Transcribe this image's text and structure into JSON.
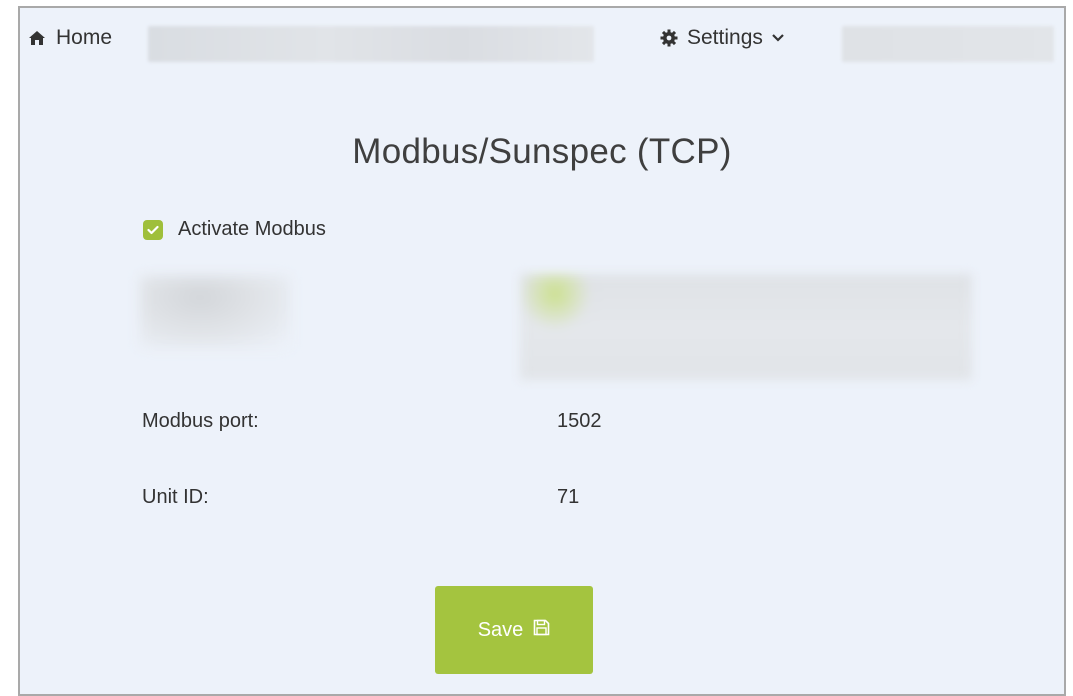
{
  "nav": {
    "home_label": "Home",
    "home_icon": "home-icon",
    "settings_label": "Settings",
    "settings_icon": "gear-icon",
    "dropdown_icon": "caret-down-icon"
  },
  "page": {
    "title": "Modbus/Sunspec (TCP)"
  },
  "activate": {
    "label": "Activate Modbus",
    "checked": true
  },
  "fields": {
    "port": {
      "label": "Modbus port:",
      "value": "1502"
    },
    "unit": {
      "label": "Unit ID:",
      "value": "71"
    }
  },
  "save": {
    "label": "Save",
    "icon": "floppy-disk-icon"
  },
  "colors": {
    "background": "#edf2fa",
    "accent": "#a4c43f",
    "checkbox": "#9fbf3b",
    "text": "#333333"
  }
}
